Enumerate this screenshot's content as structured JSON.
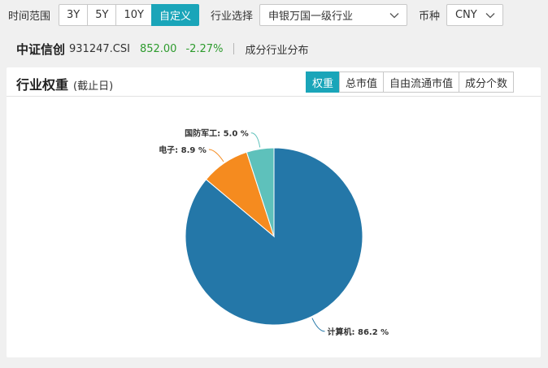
{
  "toolbar": {
    "range_label": "时间范围",
    "range_options": [
      "3Y",
      "5Y",
      "10Y",
      "自定义"
    ],
    "range_selected": "自定义",
    "industry_label": "行业选择",
    "industry_value": "申银万国一级行业",
    "currency_label": "币种",
    "currency_value": "CNY"
  },
  "index": {
    "name": "中证信创",
    "code": "931247.CSI",
    "price": "852.00",
    "change": "-2.27%",
    "subtitle": "成分行业分布"
  },
  "panel": {
    "title": "行业权重",
    "title_note": "(截止日)",
    "tabs": [
      "权重",
      "总市值",
      "自由流通市值",
      "成分个数"
    ],
    "active_tab": "权重"
  },
  "colors": {
    "accent": "#1aa5b9",
    "price_up": "#2d9b2d",
    "slice_1": "#2477a8",
    "slice_2": "#f58b1f",
    "slice_3": "#5ec1bb"
  },
  "chart_data": {
    "type": "pie",
    "categories": [
      "计算机",
      "电子",
      "国防军工"
    ],
    "values": [
      86.2,
      8.9,
      5.0
    ],
    "unit": "%",
    "labels": [
      "计算机: 86.2 %",
      "电子: 8.9 %",
      "国防军工: 5.0 %"
    ],
    "colors": [
      "#2477a8",
      "#f58b1f",
      "#5ec1bb"
    ],
    "start_angle_deg": 0,
    "direction": "clockwise"
  }
}
